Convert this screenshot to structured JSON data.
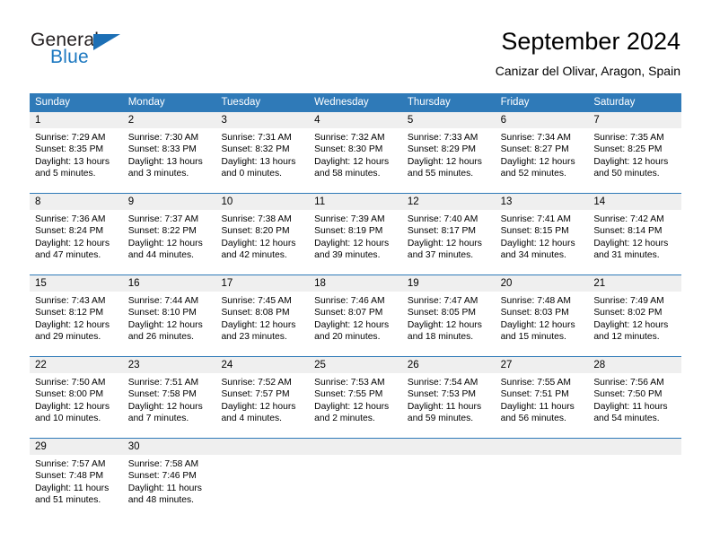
{
  "brand": {
    "name_top": "General",
    "name_bottom": "Blue",
    "flag_icon": "triangle-flag-icon",
    "color_top": "#231f20",
    "color_bottom": "#1c78c0"
  },
  "header": {
    "title": "September 2024",
    "subtitle": "Canizar del Olivar, Aragon, Spain"
  },
  "theme": {
    "accent": "#2f7ab8",
    "daynum_band": "#efefef",
    "text": "#000000"
  },
  "calendar": {
    "weekday_headers": [
      "Sunday",
      "Monday",
      "Tuesday",
      "Wednesday",
      "Thursday",
      "Friday",
      "Saturday"
    ],
    "weeks": [
      [
        {
          "day": "1",
          "sunrise": "Sunrise: 7:29 AM",
          "sunset": "Sunset: 8:35 PM",
          "daylight_1": "Daylight: 13 hours",
          "daylight_2": "and 5 minutes."
        },
        {
          "day": "2",
          "sunrise": "Sunrise: 7:30 AM",
          "sunset": "Sunset: 8:33 PM",
          "daylight_1": "Daylight: 13 hours",
          "daylight_2": "and 3 minutes."
        },
        {
          "day": "3",
          "sunrise": "Sunrise: 7:31 AM",
          "sunset": "Sunset: 8:32 PM",
          "daylight_1": "Daylight: 13 hours",
          "daylight_2": "and 0 minutes."
        },
        {
          "day": "4",
          "sunrise": "Sunrise: 7:32 AM",
          "sunset": "Sunset: 8:30 PM",
          "daylight_1": "Daylight: 12 hours",
          "daylight_2": "and 58 minutes."
        },
        {
          "day": "5",
          "sunrise": "Sunrise: 7:33 AM",
          "sunset": "Sunset: 8:29 PM",
          "daylight_1": "Daylight: 12 hours",
          "daylight_2": "and 55 minutes."
        },
        {
          "day": "6",
          "sunrise": "Sunrise: 7:34 AM",
          "sunset": "Sunset: 8:27 PM",
          "daylight_1": "Daylight: 12 hours",
          "daylight_2": "and 52 minutes."
        },
        {
          "day": "7",
          "sunrise": "Sunrise: 7:35 AM",
          "sunset": "Sunset: 8:25 PM",
          "daylight_1": "Daylight: 12 hours",
          "daylight_2": "and 50 minutes."
        }
      ],
      [
        {
          "day": "8",
          "sunrise": "Sunrise: 7:36 AM",
          "sunset": "Sunset: 8:24 PM",
          "daylight_1": "Daylight: 12 hours",
          "daylight_2": "and 47 minutes."
        },
        {
          "day": "9",
          "sunrise": "Sunrise: 7:37 AM",
          "sunset": "Sunset: 8:22 PM",
          "daylight_1": "Daylight: 12 hours",
          "daylight_2": "and 44 minutes."
        },
        {
          "day": "10",
          "sunrise": "Sunrise: 7:38 AM",
          "sunset": "Sunset: 8:20 PM",
          "daylight_1": "Daylight: 12 hours",
          "daylight_2": "and 42 minutes."
        },
        {
          "day": "11",
          "sunrise": "Sunrise: 7:39 AM",
          "sunset": "Sunset: 8:19 PM",
          "daylight_1": "Daylight: 12 hours",
          "daylight_2": "and 39 minutes."
        },
        {
          "day": "12",
          "sunrise": "Sunrise: 7:40 AM",
          "sunset": "Sunset: 8:17 PM",
          "daylight_1": "Daylight: 12 hours",
          "daylight_2": "and 37 minutes."
        },
        {
          "day": "13",
          "sunrise": "Sunrise: 7:41 AM",
          "sunset": "Sunset: 8:15 PM",
          "daylight_1": "Daylight: 12 hours",
          "daylight_2": "and 34 minutes."
        },
        {
          "day": "14",
          "sunrise": "Sunrise: 7:42 AM",
          "sunset": "Sunset: 8:14 PM",
          "daylight_1": "Daylight: 12 hours",
          "daylight_2": "and 31 minutes."
        }
      ],
      [
        {
          "day": "15",
          "sunrise": "Sunrise: 7:43 AM",
          "sunset": "Sunset: 8:12 PM",
          "daylight_1": "Daylight: 12 hours",
          "daylight_2": "and 29 minutes."
        },
        {
          "day": "16",
          "sunrise": "Sunrise: 7:44 AM",
          "sunset": "Sunset: 8:10 PM",
          "daylight_1": "Daylight: 12 hours",
          "daylight_2": "and 26 minutes."
        },
        {
          "day": "17",
          "sunrise": "Sunrise: 7:45 AM",
          "sunset": "Sunset: 8:08 PM",
          "daylight_1": "Daylight: 12 hours",
          "daylight_2": "and 23 minutes."
        },
        {
          "day": "18",
          "sunrise": "Sunrise: 7:46 AM",
          "sunset": "Sunset: 8:07 PM",
          "daylight_1": "Daylight: 12 hours",
          "daylight_2": "and 20 minutes."
        },
        {
          "day": "19",
          "sunrise": "Sunrise: 7:47 AM",
          "sunset": "Sunset: 8:05 PM",
          "daylight_1": "Daylight: 12 hours",
          "daylight_2": "and 18 minutes."
        },
        {
          "day": "20",
          "sunrise": "Sunrise: 7:48 AM",
          "sunset": "Sunset: 8:03 PM",
          "daylight_1": "Daylight: 12 hours",
          "daylight_2": "and 15 minutes."
        },
        {
          "day": "21",
          "sunrise": "Sunrise: 7:49 AM",
          "sunset": "Sunset: 8:02 PM",
          "daylight_1": "Daylight: 12 hours",
          "daylight_2": "and 12 minutes."
        }
      ],
      [
        {
          "day": "22",
          "sunrise": "Sunrise: 7:50 AM",
          "sunset": "Sunset: 8:00 PM",
          "daylight_1": "Daylight: 12 hours",
          "daylight_2": "and 10 minutes."
        },
        {
          "day": "23",
          "sunrise": "Sunrise: 7:51 AM",
          "sunset": "Sunset: 7:58 PM",
          "daylight_1": "Daylight: 12 hours",
          "daylight_2": "and 7 minutes."
        },
        {
          "day": "24",
          "sunrise": "Sunrise: 7:52 AM",
          "sunset": "Sunset: 7:57 PM",
          "daylight_1": "Daylight: 12 hours",
          "daylight_2": "and 4 minutes."
        },
        {
          "day": "25",
          "sunrise": "Sunrise: 7:53 AM",
          "sunset": "Sunset: 7:55 PM",
          "daylight_1": "Daylight: 12 hours",
          "daylight_2": "and 2 minutes."
        },
        {
          "day": "26",
          "sunrise": "Sunrise: 7:54 AM",
          "sunset": "Sunset: 7:53 PM",
          "daylight_1": "Daylight: 11 hours",
          "daylight_2": "and 59 minutes."
        },
        {
          "day": "27",
          "sunrise": "Sunrise: 7:55 AM",
          "sunset": "Sunset: 7:51 PM",
          "daylight_1": "Daylight: 11 hours",
          "daylight_2": "and 56 minutes."
        },
        {
          "day": "28",
          "sunrise": "Sunrise: 7:56 AM",
          "sunset": "Sunset: 7:50 PM",
          "daylight_1": "Daylight: 11 hours",
          "daylight_2": "and 54 minutes."
        }
      ],
      [
        {
          "day": "29",
          "sunrise": "Sunrise: 7:57 AM",
          "sunset": "Sunset: 7:48 PM",
          "daylight_1": "Daylight: 11 hours",
          "daylight_2": "and 51 minutes."
        },
        {
          "day": "30",
          "sunrise": "Sunrise: 7:58 AM",
          "sunset": "Sunset: 7:46 PM",
          "daylight_1": "Daylight: 11 hours",
          "daylight_2": "and 48 minutes."
        },
        {
          "day": "",
          "sunrise": "",
          "sunset": "",
          "daylight_1": "",
          "daylight_2": ""
        },
        {
          "day": "",
          "sunrise": "",
          "sunset": "",
          "daylight_1": "",
          "daylight_2": ""
        },
        {
          "day": "",
          "sunrise": "",
          "sunset": "",
          "daylight_1": "",
          "daylight_2": ""
        },
        {
          "day": "",
          "sunrise": "",
          "sunset": "",
          "daylight_1": "",
          "daylight_2": ""
        },
        {
          "day": "",
          "sunrise": "",
          "sunset": "",
          "daylight_1": "",
          "daylight_2": ""
        }
      ]
    ]
  }
}
